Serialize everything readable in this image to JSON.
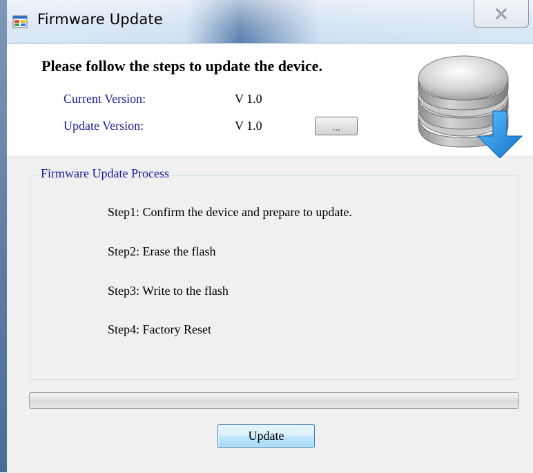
{
  "window": {
    "title": "Firmware Update",
    "close_label": "✕"
  },
  "header": {
    "headline": "Please follow the steps to update the device.",
    "current_version_label": "Current Version:",
    "current_version_value": "V 1.0",
    "update_version_label": "Update Version:",
    "update_version_value": "V 1.0",
    "browse_label": "..."
  },
  "process": {
    "group_title": "Firmware Update Process",
    "steps": [
      "Step1: Confirm the device and prepare to update.",
      "Step2: Erase the flash",
      "Step3: Write to the flash",
      "Step4: Factory Reset"
    ]
  },
  "progress": {
    "value": 0
  },
  "actions": {
    "update_label": "Update"
  },
  "colors": {
    "label_blue": "#1a1a9c",
    "arrow_blue": "#1e8ee6",
    "client_bg": "#f0f0f0"
  },
  "icons": {
    "app": "app-window-icon",
    "close": "close-icon",
    "database_download": "database-download-icon"
  }
}
